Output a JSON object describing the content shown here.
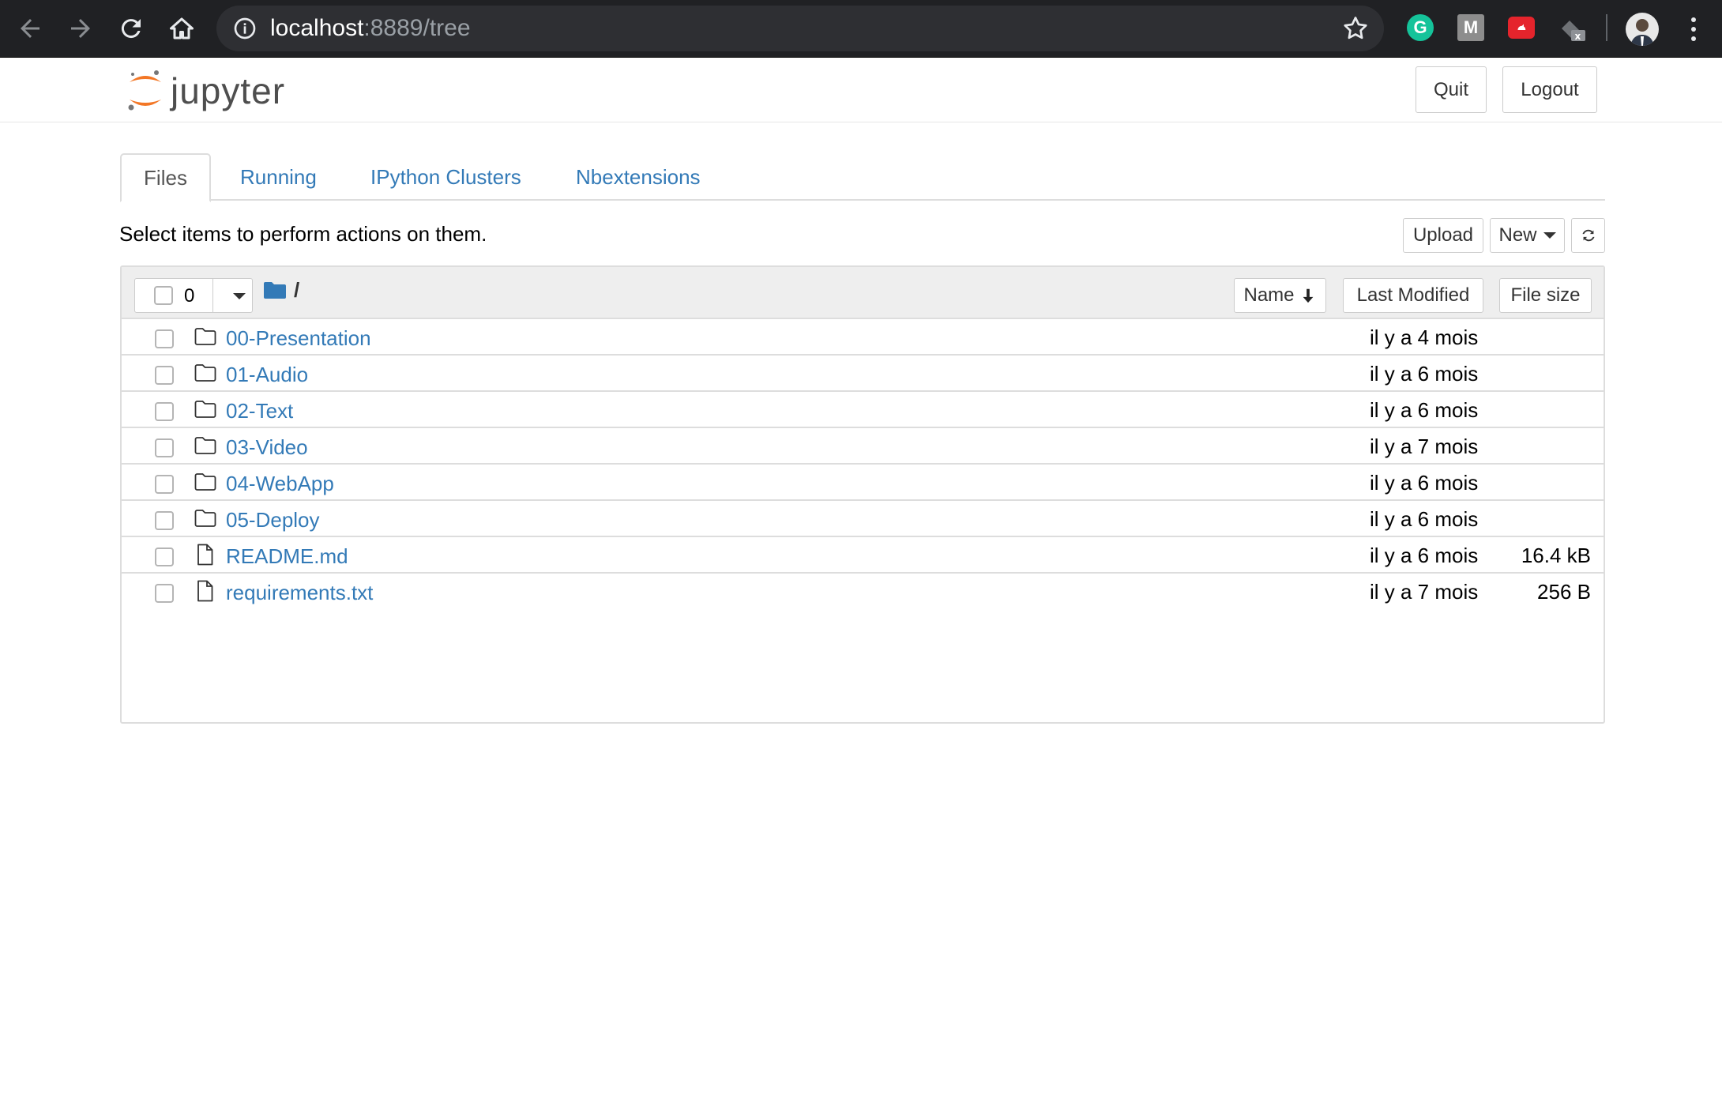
{
  "browser": {
    "url_host": "localhost",
    "url_rest": ":8889/tree",
    "extensions": [
      "G",
      "M",
      "",
      "x"
    ]
  },
  "header": {
    "logo_text": "jupyter",
    "quit_label": "Quit",
    "logout_label": "Logout"
  },
  "tabs": [
    {
      "label": "Files",
      "active": true
    },
    {
      "label": "Running",
      "active": false
    },
    {
      "label": "IPython Clusters",
      "active": false
    },
    {
      "label": "Nbextensions",
      "active": false
    }
  ],
  "toolbar": {
    "hint": "Select items to perform actions on them.",
    "upload_label": "Upload",
    "new_label": "New"
  },
  "list_header": {
    "selected_count": "0",
    "breadcrumb": "/",
    "sort_name_label": "Name",
    "sort_modified_label": "Last Modified",
    "sort_size_label": "File size"
  },
  "files": [
    {
      "name": "00-Presentation",
      "type": "folder",
      "modified": "il y a 4 mois",
      "size": ""
    },
    {
      "name": "01-Audio",
      "type": "folder",
      "modified": "il y a 6 mois",
      "size": ""
    },
    {
      "name": "02-Text",
      "type": "folder",
      "modified": "il y a 6 mois",
      "size": ""
    },
    {
      "name": "03-Video",
      "type": "folder",
      "modified": "il y a 7 mois",
      "size": ""
    },
    {
      "name": "04-WebApp",
      "type": "folder",
      "modified": "il y a 6 mois",
      "size": ""
    },
    {
      "name": "05-Deploy",
      "type": "folder",
      "modified": "il y a 6 mois",
      "size": ""
    },
    {
      "name": "README.md",
      "type": "file",
      "modified": "il y a 6 mois",
      "size": "16.4 kB"
    },
    {
      "name": "requirements.txt",
      "type": "file",
      "modified": "il y a 7 mois",
      "size": "256 B"
    }
  ],
  "colors": {
    "link": "#337ab7",
    "chrome_bg": "#202124",
    "logo_orange": "#f37726"
  }
}
